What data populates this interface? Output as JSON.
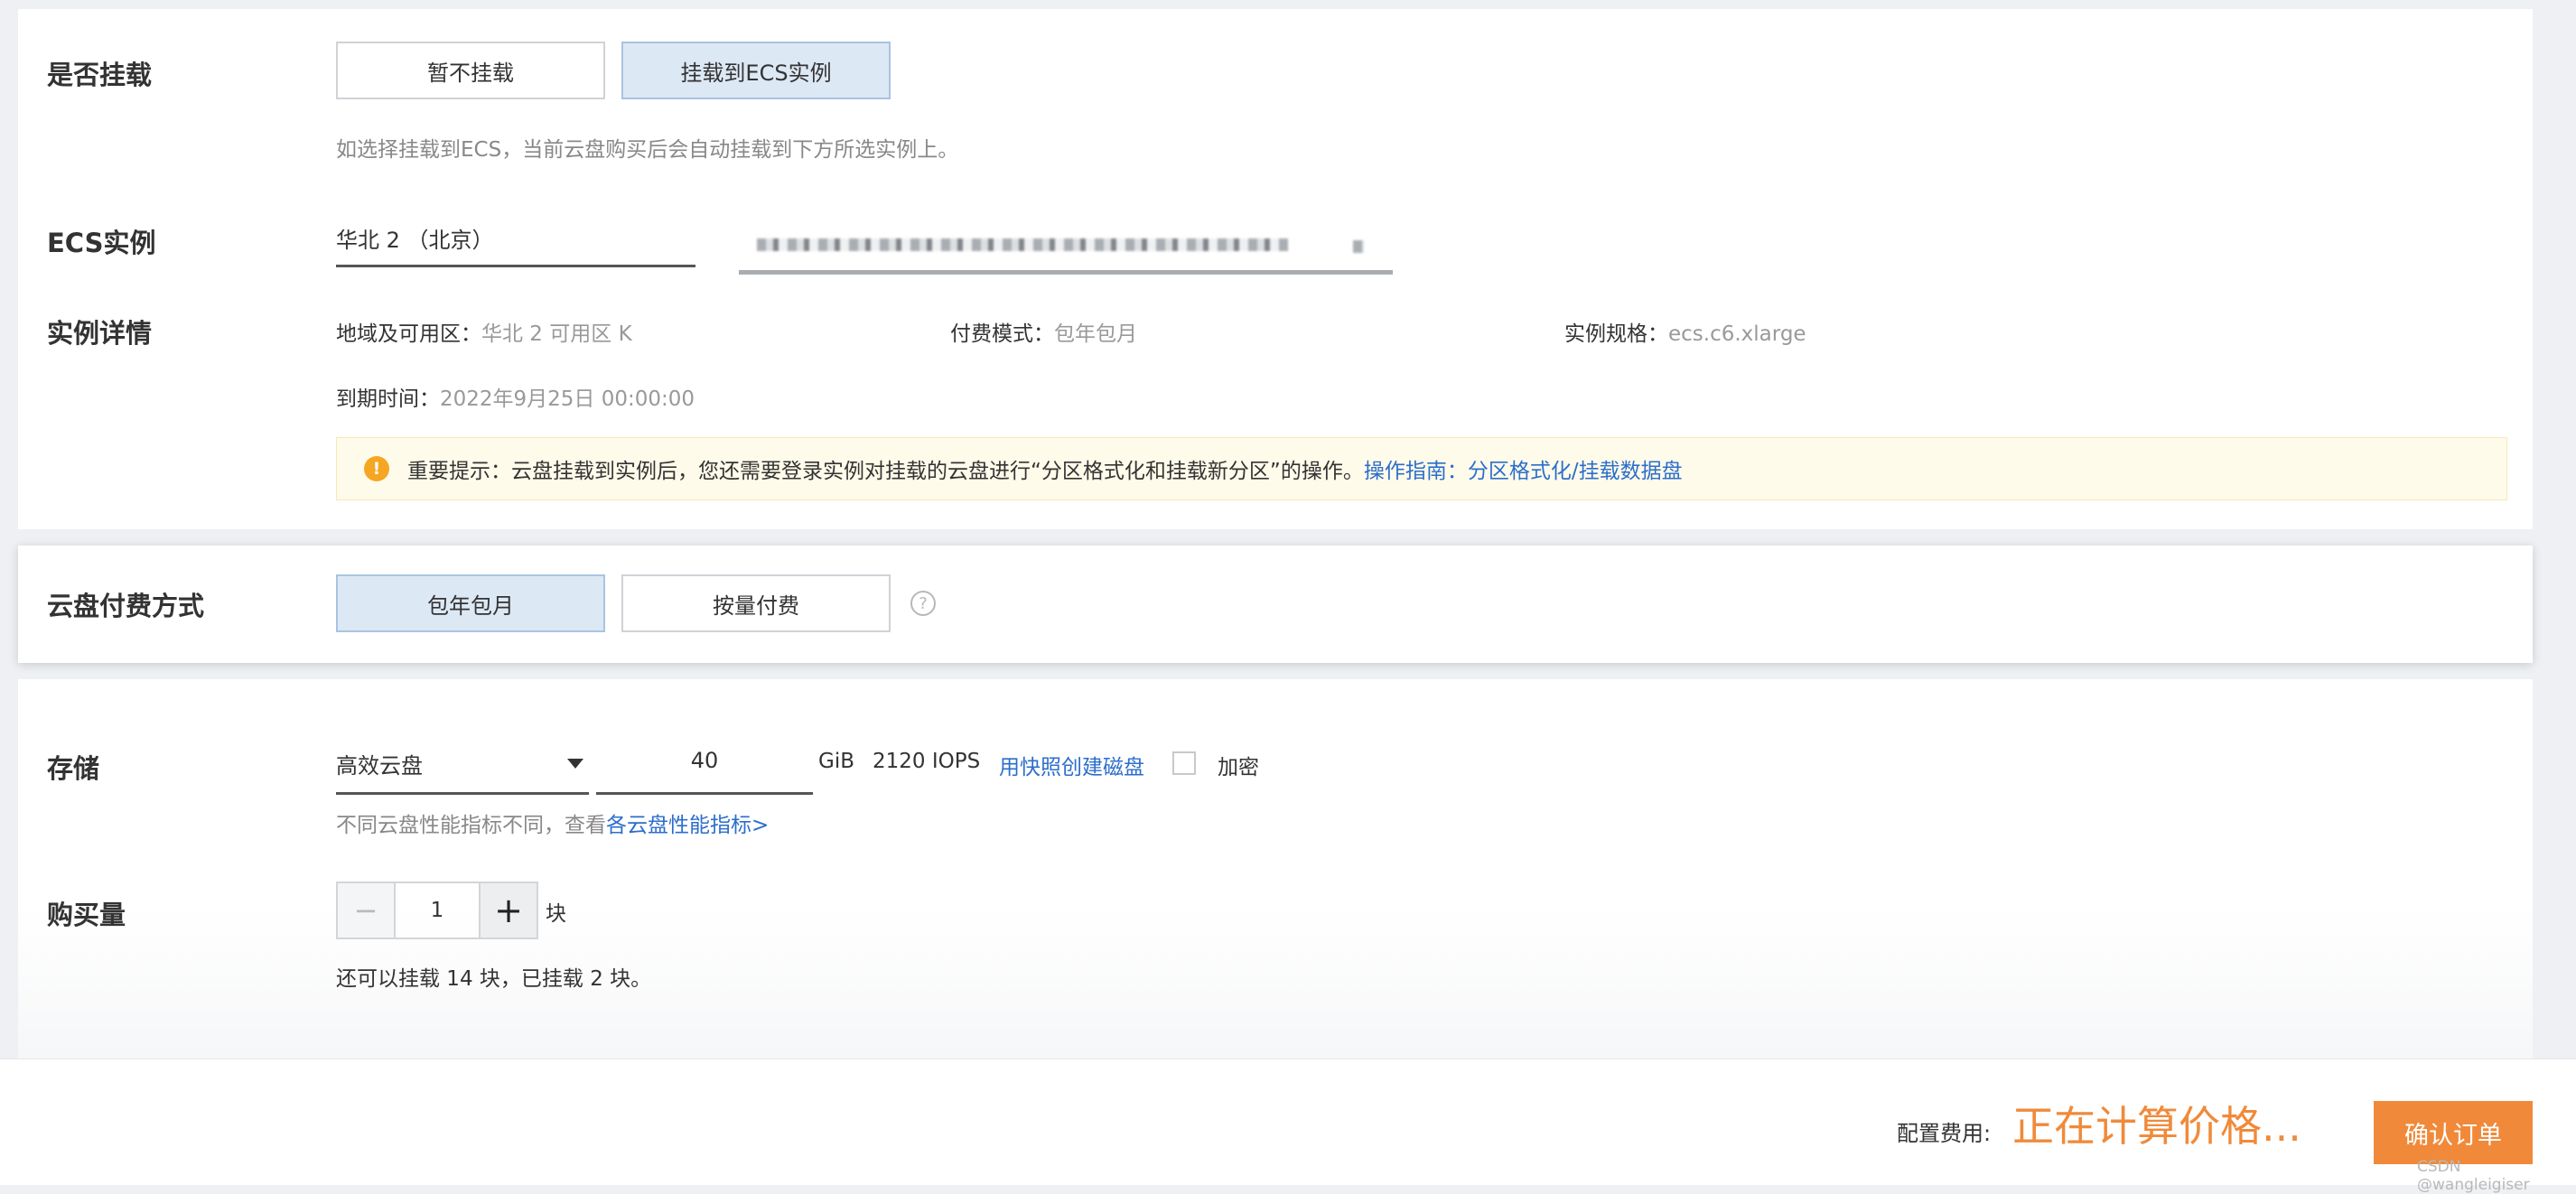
{
  "mount": {
    "label": "是否挂载",
    "options": [
      "暂不挂载",
      "挂载到ECS实例"
    ],
    "selected_index": 1,
    "hint": "如选择挂载到ECS，当前云盘购买后会自动挂载到下方所选实例上。"
  },
  "ecs": {
    "label": "ECS实例",
    "region_value": "华北 2 （北京）"
  },
  "details": {
    "label": "实例详情",
    "zone_label": "地域及可用区：",
    "zone_value": "华北 2 可用区 K",
    "billing_label": "付费模式：",
    "billing_value": "包年包月",
    "spec_label": "实例规格：",
    "spec_value": "ecs.c6.xlarge",
    "expire_label": "到期时间：",
    "expire_value": "2022年9月25日 00:00:00"
  },
  "notice": {
    "icon": "exclamation-icon",
    "text": "重要提示：云盘挂载到实例后，您还需要登录实例对挂载的云盘进行“分区格式化和挂载新分区”的操作。",
    "link": "操作指南：分区格式化/挂载数据盘"
  },
  "billing": {
    "label": "云盘付费方式",
    "options": [
      "包年包月",
      "按量付费"
    ],
    "selected_index": 0,
    "help_glyph": "?"
  },
  "storage": {
    "label": "存储",
    "disk_type": "高效云盘",
    "size": "40",
    "unit": "GiB",
    "iops": "2120 IOPS",
    "snapshot_link": "用快照创建磁盘",
    "encrypt_label": "加密",
    "encrypt_checked": false,
    "hint_text": "不同云盘性能指标不同，查看",
    "hint_link": "各云盘性能指标>"
  },
  "quantity": {
    "label": "购买量",
    "minus": "−",
    "value": "1",
    "plus": "+",
    "unit": "块",
    "note": "还可以挂载 14 块，已挂载 2 块。"
  },
  "footer": {
    "price_label": "配置费用:",
    "price_value": "正在计算价格...",
    "confirm": "确认订单"
  },
  "watermark": "CSDN @wangleigiser",
  "colors": {
    "accent_orange": "#f08a3a",
    "link_blue": "#2c6ecb",
    "selected_fill": "#dde8f5",
    "warning": "#f5a623"
  }
}
